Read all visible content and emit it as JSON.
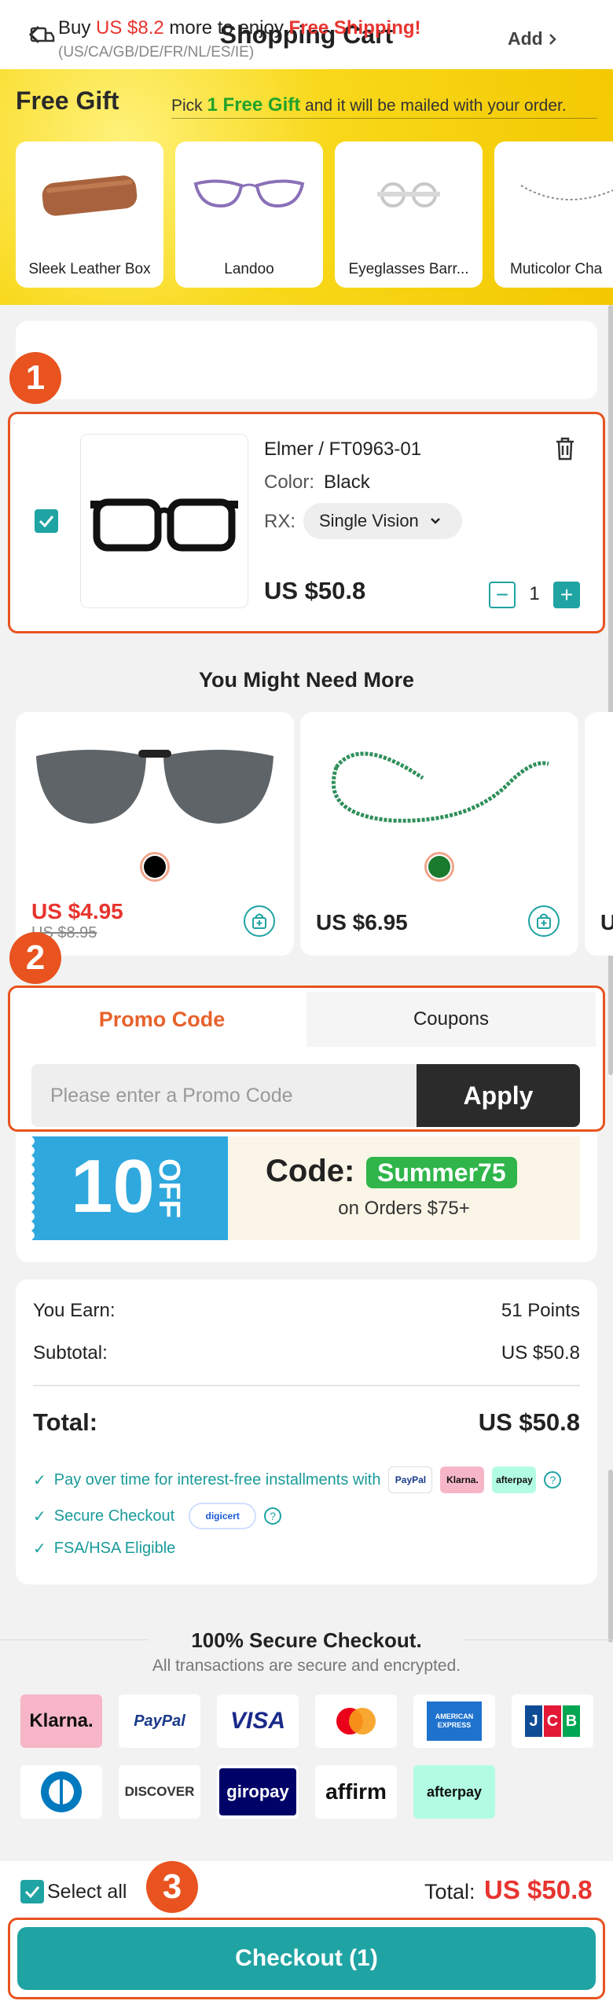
{
  "header": {
    "title": "Shopping Cart",
    "back_icon": "chevron-left-icon"
  },
  "free_gift": {
    "title": "Free Gift",
    "subtitle_prefix": "Pick ",
    "subtitle_highlight": "1 Free Gift",
    "subtitle_suffix": " and it will be mailed with your order.",
    "items": [
      {
        "name": "Sleek Leather Box"
      },
      {
        "name": "Landoo"
      },
      {
        "name": "Eyeglasses Barr..."
      },
      {
        "name": "Muticolor Cha"
      }
    ]
  },
  "shipping": {
    "text_prefix": "Buy ",
    "amount": "US $8.2",
    "text_middle": " more to enjoy ",
    "free_shipping": "Free Shipping!",
    "regions": "(US/CA/GB/DE/FR/NL/ES/IE)",
    "add_label": "Add"
  },
  "steps": {
    "one": "1",
    "two": "2",
    "three": "3"
  },
  "cart_item": {
    "name": "Elmer / FT0963-01",
    "color_label": "Color:",
    "color_value": "Black",
    "rx_label": "RX:",
    "rx_value": "Single Vision",
    "price": "US $50.8",
    "quantity": "1",
    "checked": true
  },
  "recommendations": {
    "title": "You Might Need More",
    "items": [
      {
        "price": "US $4.95",
        "old_price": "US $8.95",
        "swatch": "#000000",
        "sale": true
      },
      {
        "price": "US $6.95",
        "swatch": "#1a7a2e",
        "sale": false
      }
    ],
    "partial_price": "U"
  },
  "promo": {
    "tab_promo": "Promo Code",
    "tab_coupons": "Coupons",
    "placeholder": "Please enter a Promo Code",
    "apply_label": "Apply"
  },
  "coupon_banner": {
    "big_number": "10",
    "off": "OFF",
    "code_label": "Code:",
    "code_value": "Summer75",
    "condition": "on Orders $75+"
  },
  "summary": {
    "earn_label": "You Earn:",
    "earn_value": "51 Points",
    "subtotal_label": "Subtotal:",
    "subtotal_value": "US $50.8",
    "total_label": "Total:",
    "total_value": "US $50.8",
    "features": [
      "Pay over time for interest-free installments with",
      "Secure Checkout",
      "FSA/HSA Eligible"
    ],
    "pay_chips": [
      "PayPal",
      "Klarna.",
      "afterpay"
    ],
    "digicert": "digicert"
  },
  "secure": {
    "title": "100% Secure Checkout.",
    "subtitle": "All transactions are secure and encrypted.",
    "methods_row1": [
      "Klarna.",
      "PayPal",
      "VISA",
      "mastercard",
      "AMERICAN EXPRESS",
      "JCB"
    ],
    "methods_row2": [
      "Diners",
      "DISCOVER",
      "giropay",
      "affirm",
      "afterpay"
    ]
  },
  "bottom": {
    "select_all": "Select all",
    "total_label": "Total:",
    "total_value": "US $50.8",
    "checkout_label": "Checkout (1)"
  },
  "colors": {
    "accent": "#1fa3a3",
    "highlight": "#e8531f",
    "price_red": "#e8342f",
    "gift_green": "#22a22a"
  }
}
